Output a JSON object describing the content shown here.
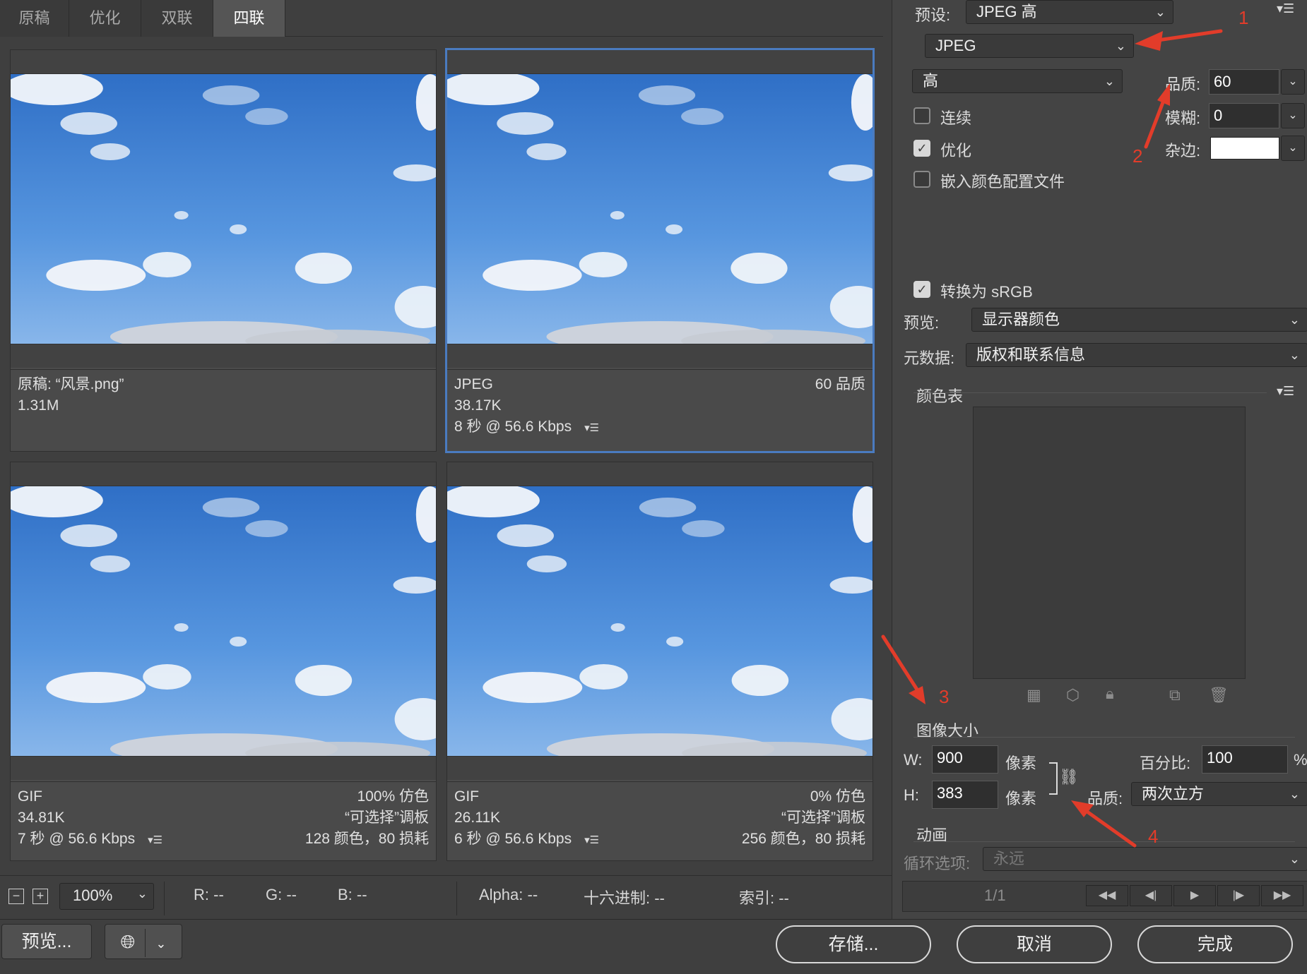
{
  "tabs": [
    "原稿",
    "优化",
    "双联",
    "四联"
  ],
  "active_tab": "四联",
  "panes": [
    {
      "id": "original",
      "left1": "原稿: “风景.png”",
      "left2": "1.31M",
      "left3": "",
      "right1": "",
      "right2": "",
      "right3": "",
      "selected": false
    },
    {
      "id": "jpeg",
      "left1": "JPEG",
      "left2": "38.17K",
      "left3": "8 秒 @ 56.6 Kbps",
      "right1": "60 品质",
      "right2": "",
      "right3": "",
      "selected": true
    },
    {
      "id": "gif1",
      "left1": "GIF",
      "left2": "34.81K",
      "left3": "7 秒 @ 56.6 Kbps",
      "right1": "100% 仿色",
      "right2": "“可选择”调板",
      "right3": "128 颜色，80 损耗",
      "selected": false
    },
    {
      "id": "gif2",
      "left1": "GIF",
      "left2": "26.11K",
      "left3": "6 秒 @ 56.6 Kbps",
      "right1": "0% 仿色",
      "right2": "“可选择”调板",
      "right3": "256 颜色，80 损耗",
      "selected": false
    }
  ],
  "settings": {
    "preset_label": "预设:",
    "preset_value": "JPEG 高",
    "format_value": "JPEG",
    "quality_level": "高",
    "quality_label": "品质:",
    "quality_value": "60",
    "blur_label": "模糊:",
    "blur_value": "0",
    "matte_label": "杂边:",
    "progressive_label": "连续",
    "progressive_checked": false,
    "optimized_label": "优化",
    "optimized_checked": true,
    "embed_profile_label": "嵌入颜色配置文件",
    "embed_profile_checked": false,
    "srgb_label": "转换为 sRGB",
    "srgb_checked": true,
    "preview_label": "预览:",
    "preview_value": "显示器颜色",
    "metadata_label": "元数据:",
    "metadata_value": "版权和联系信息"
  },
  "color_table": {
    "title": "颜色表"
  },
  "image_size": {
    "title": "图像大小",
    "w_label": "W:",
    "w_value": "900",
    "h_label": "H:",
    "h_value": "383",
    "unit": "像素",
    "percent_label": "百分比:",
    "percent_value": "100",
    "percent_sign": "%",
    "quality_label": "品质:",
    "quality_value": "两次立方"
  },
  "animation": {
    "title": "动画",
    "loop_label": "循环选项:",
    "loop_value": "永远",
    "frame_counter": "1/1"
  },
  "annotations": [
    "1",
    "2",
    "3",
    "4"
  ],
  "status": {
    "zoom": "100%",
    "r": "R: --",
    "g": "G: --",
    "b": "B: --",
    "alpha": "Alpha: --",
    "hex": "十六进制: --",
    "index": "索引: --"
  },
  "buttons": {
    "preview": "预览...",
    "save": "存储...",
    "cancel": "取消",
    "done": "完成"
  },
  "colors": {
    "accent": "#4a7bc0",
    "annotation": "#e23c2a"
  }
}
